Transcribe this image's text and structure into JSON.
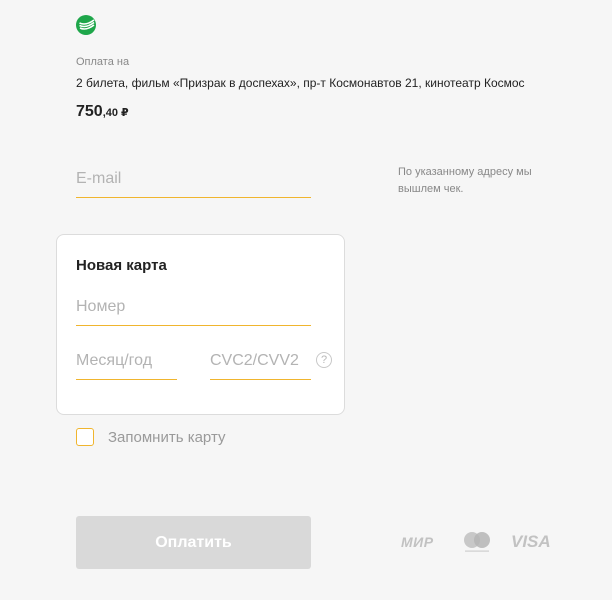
{
  "header": {
    "logo": "sberbank-logo",
    "pay_label": "Оплата на",
    "merchant": "",
    "description": "2 билета, фильм «Призрак в доспехах», пр-т Космонавтов 21, кинотеатр Космос",
    "amount_int": "750",
    "amount_frac": ",40",
    "currency": "₽"
  },
  "email": {
    "placeholder": "E-mail",
    "value": "",
    "hint": "По указанному адресу мы вышлем чек."
  },
  "card": {
    "title": "Новая карта",
    "number_placeholder": "Номер",
    "expiry_placeholder": "Месяц/год",
    "cvc_placeholder": "CVC2/CVV2",
    "help_icon": "?"
  },
  "remember": {
    "label": "Запомнить карту",
    "checked": false
  },
  "pay_button": {
    "label": "Оплатить"
  },
  "payment_systems": {
    "mir": "МИР",
    "mastercard": "mastercard-logo",
    "visa": "VISA"
  },
  "colors": {
    "accent": "#f0b52e",
    "logo_green": "#1ea64a",
    "button_disabled": "#d9d9d9",
    "background": "#f6f6f6"
  }
}
